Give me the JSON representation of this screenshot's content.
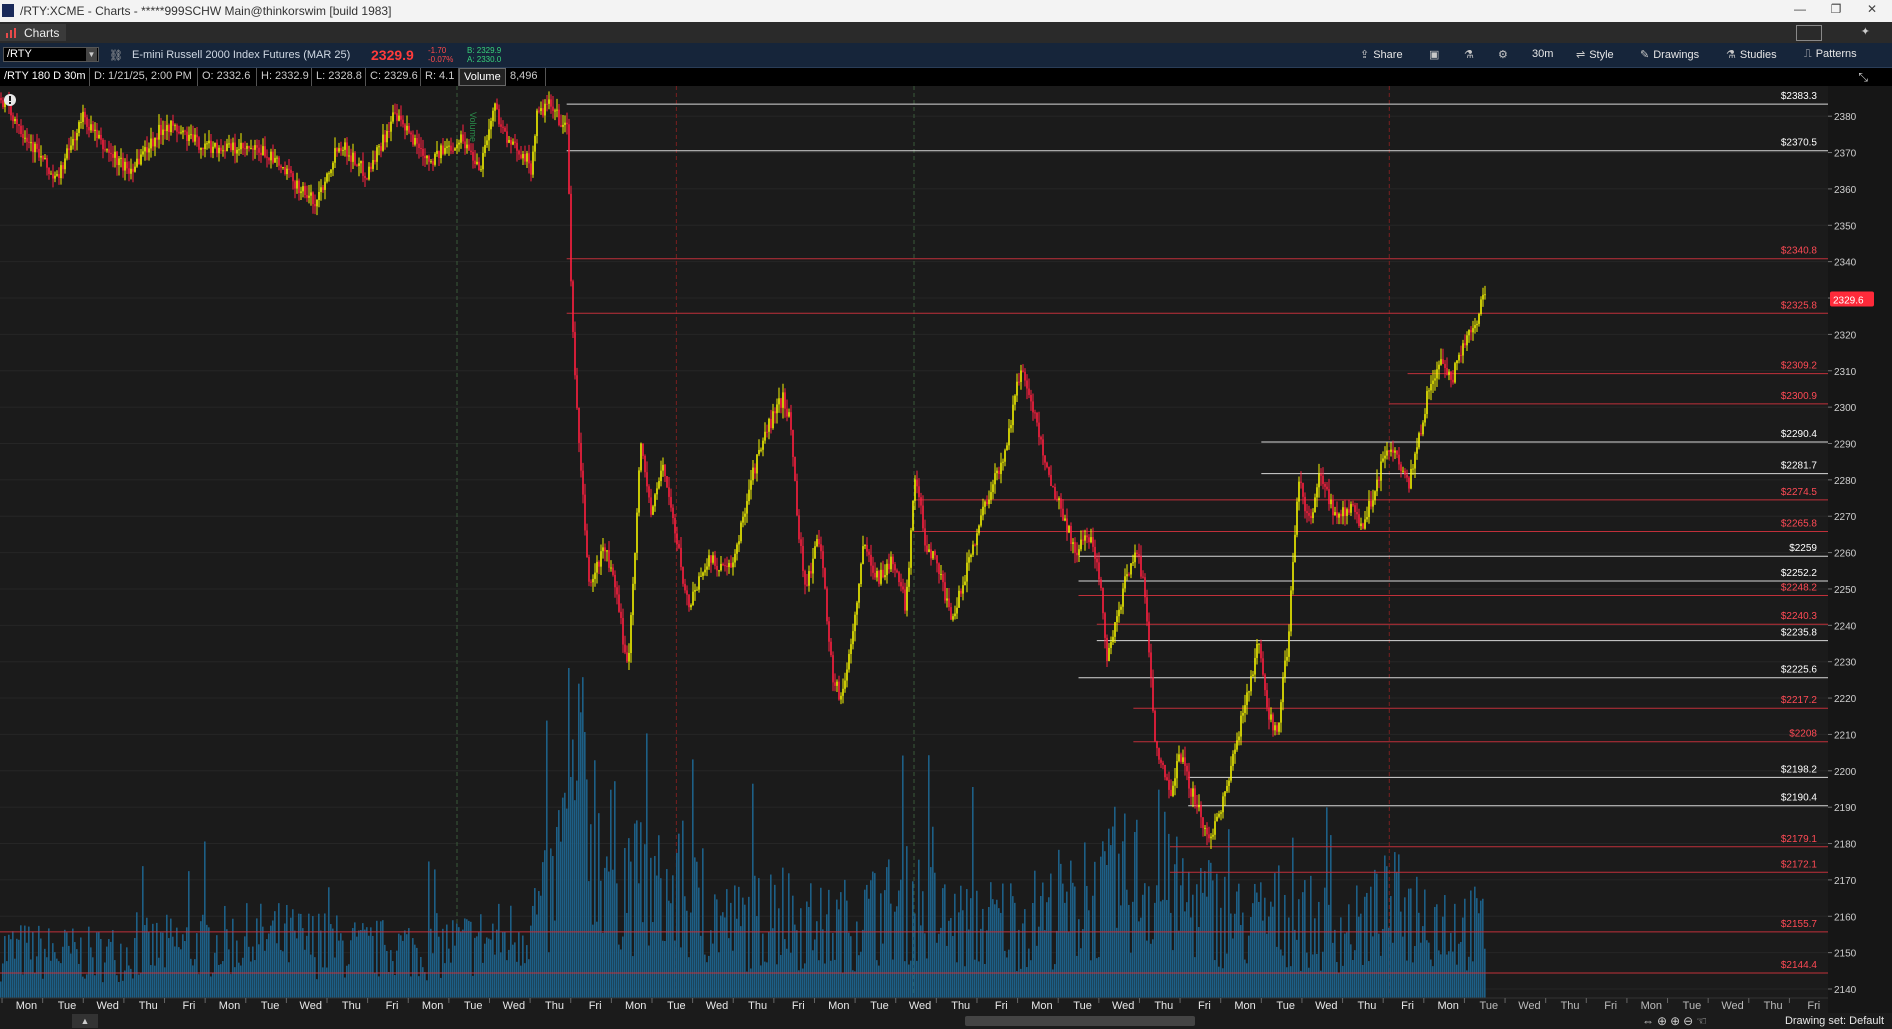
{
  "window": {
    "title": "/RTY:XCME - Charts - *****999SCHW Main@thinkorswim [build 1983]",
    "controls": [
      "—",
      "❐",
      "✕"
    ]
  },
  "tab": {
    "label": "Charts"
  },
  "toolbar": {
    "symbol": "/RTY",
    "description": "E-mini Russell 2000 Index Futures (MAR 25)",
    "last_price": "2329.9",
    "net_change": "-1.70",
    "pct_change": "-0.07%",
    "bid": "B: 2329.9",
    "ask": "A: 2330.0",
    "share_label": "Share",
    "interval_label": "30m",
    "style_label": "Style",
    "drawings_label": "Drawings",
    "studies_label": "Studies",
    "patterns_label": "Patterns"
  },
  "infobar": {
    "cells": [
      "/RTY 180 D 30m",
      "D: 1/21/25, 2:00 PM",
      "O: 2332.6",
      "H: 2332.9",
      "L: 2328.8",
      "C: 2329.6",
      "R: 4.1",
      "Volume",
      "8,496"
    ]
  },
  "chart_data": {
    "type": "candlestick",
    "instrument": "/RTY",
    "price_axis": {
      "min": 2140,
      "max": 2385,
      "step": 10,
      "ticks": [
        2140,
        2150,
        2160,
        2170,
        2180,
        2190,
        2200,
        2210,
        2220,
        2230,
        2240,
        2250,
        2260,
        2270,
        2280,
        2290,
        2300,
        2310,
        2320,
        2330,
        2340,
        2350,
        2360,
        2370,
        2380
      ]
    },
    "current_price": {
      "label": "2329.6",
      "value": 2329.6,
      "color": "#ff2a3a"
    },
    "price_levels": [
      {
        "label": "$2383.3",
        "value": 2383.3,
        "color": "white",
        "start": 0.31
      },
      {
        "label": "$2370.5",
        "value": 2370.5,
        "color": "white",
        "start": 0.31
      },
      {
        "label": "$2340.8",
        "value": 2340.8,
        "color": "red",
        "start": 0.31
      },
      {
        "label": "$2325.8",
        "value": 2325.8,
        "color": "red",
        "start": 0.31
      },
      {
        "label": "$2309.2",
        "value": 2309.2,
        "color": "red",
        "start": 0.77
      },
      {
        "label": "$2300.9",
        "value": 2300.9,
        "color": "red",
        "start": 0.76
      },
      {
        "label": "$2290.4",
        "value": 2290.4,
        "color": "white",
        "start": 0.69
      },
      {
        "label": "$2281.7",
        "value": 2281.7,
        "color": "white",
        "start": 0.69
      },
      {
        "label": "$2274.5",
        "value": 2274.5,
        "color": "red",
        "start": 0.5
      },
      {
        "label": "$2265.8",
        "value": 2265.8,
        "color": "red",
        "start": 0.5
      },
      {
        "label": "$2259",
        "value": 2259,
        "color": "white",
        "start": 0.59
      },
      {
        "label": "$2252.2",
        "value": 2252.2,
        "color": "white",
        "start": 0.59
      },
      {
        "label": "$2248.2",
        "value": 2248.2,
        "color": "red",
        "start": 0.59
      },
      {
        "label": "$2240.3",
        "value": 2240.3,
        "color": "red",
        "start": 0.6
      },
      {
        "label": "$2235.8",
        "value": 2235.8,
        "color": "white",
        "start": 0.6
      },
      {
        "label": "$2225.6",
        "value": 2225.6,
        "color": "white",
        "start": 0.59
      },
      {
        "label": "$2217.2",
        "value": 2217.2,
        "color": "red",
        "start": 0.62
      },
      {
        "label": "$2208",
        "value": 2208,
        "color": "red",
        "start": 0.62
      },
      {
        "label": "$2198.2",
        "value": 2198.2,
        "color": "white",
        "start": 0.65
      },
      {
        "label": "$2190.4",
        "value": 2190.4,
        "color": "white",
        "start": 0.65
      },
      {
        "label": "$2179.1",
        "value": 2179.1,
        "color": "red",
        "start": 0.64
      },
      {
        "label": "$2172.1",
        "value": 2172.1,
        "color": "red",
        "start": 0.64
      },
      {
        "label": "$2155.7",
        "value": 2155.7,
        "color": "red",
        "start": 0.0
      },
      {
        "label": "$2144.4",
        "value": 2144.4,
        "color": "red",
        "start": 0.0
      }
    ],
    "x_tick_labels": [
      "Mon",
      "Tue",
      "Wed",
      "Thu",
      "Fri",
      "Mon",
      "Tue",
      "Wed",
      "Thu",
      "Fri",
      "Mon",
      "Tue",
      "Wed",
      "Thu",
      "Fri",
      "Mon",
      "Tue",
      "Wed",
      "Thu",
      "Fri",
      "Mon",
      "Tue",
      "Wed",
      "Thu",
      "Fri",
      "Mon",
      "Tue",
      "Wed",
      "Thu",
      "Fri",
      "Mon",
      "Tue",
      "Wed",
      "Thu",
      "Fri",
      "Mon",
      "Tue",
      "Wed",
      "Thu",
      "Fri",
      "Mon",
      "Tue",
      "Wed",
      "Thu",
      "Fri"
    ],
    "last_data_label_index": 35,
    "day_separators_red": [
      0.37,
      0.76
    ],
    "day_separators_dashed": [
      0.25,
      0.5
    ],
    "series_label": "Volume",
    "anchors": [
      [
        0.0,
        2385
      ],
      [
        0.02,
        2370
      ],
      [
        0.03,
        2362
      ],
      [
        0.045,
        2380
      ],
      [
        0.055,
        2372
      ],
      [
        0.07,
        2365
      ],
      [
        0.09,
        2378
      ],
      [
        0.11,
        2372
      ],
      [
        0.145,
        2370
      ],
      [
        0.172,
        2356
      ],
      [
        0.185,
        2373
      ],
      [
        0.2,
        2364
      ],
      [
        0.215,
        2380
      ],
      [
        0.235,
        2368
      ],
      [
        0.252,
        2374
      ],
      [
        0.262,
        2366
      ],
      [
        0.27,
        2383
      ],
      [
        0.278,
        2372
      ],
      [
        0.286,
        2370
      ],
      [
        0.29,
        2365
      ],
      [
        0.293,
        2380
      ],
      [
        0.3,
        2383
      ],
      [
        0.31,
        2376
      ],
      [
        0.312,
        2330
      ],
      [
        0.316,
        2290
      ],
      [
        0.322,
        2250
      ],
      [
        0.33,
        2262
      ],
      [
        0.336,
        2250
      ],
      [
        0.343,
        2228
      ],
      [
        0.35,
        2290
      ],
      [
        0.356,
        2270
      ],
      [
        0.362,
        2285
      ],
      [
        0.37,
        2262
      ],
      [
        0.376,
        2245
      ],
      [
        0.386,
        2258
      ],
      [
        0.4,
        2255
      ],
      [
        0.41,
        2280
      ],
      [
        0.42,
        2295
      ],
      [
        0.428,
        2303
      ],
      [
        0.432,
        2295
      ],
      [
        0.436,
        2268
      ],
      [
        0.44,
        2250
      ],
      [
        0.448,
        2265
      ],
      [
        0.455,
        2225
      ],
      [
        0.46,
        2220
      ],
      [
        0.466,
        2238
      ],
      [
        0.472,
        2262
      ],
      [
        0.48,
        2253
      ],
      [
        0.488,
        2258
      ],
      [
        0.495,
        2245
      ],
      [
        0.5,
        2282
      ],
      [
        0.506,
        2262
      ],
      [
        0.512,
        2258
      ],
      [
        0.52,
        2240
      ],
      [
        0.528,
        2255
      ],
      [
        0.535,
        2268
      ],
      [
        0.54,
        2276
      ],
      [
        0.548,
        2285
      ],
      [
        0.553,
        2298
      ],
      [
        0.558,
        2311
      ],
      [
        0.562,
        2305
      ],
      [
        0.568,
        2292
      ],
      [
        0.575,
        2278
      ],
      [
        0.58,
        2272
      ],
      [
        0.588,
        2260
      ],
      [
        0.595,
        2265
      ],
      [
        0.6,
        2258
      ],
      [
        0.605,
        2232
      ],
      [
        0.61,
        2240
      ],
      [
        0.616,
        2255
      ],
      [
        0.622,
        2260
      ],
      [
        0.626,
        2248
      ],
      [
        0.632,
        2205
      ],
      [
        0.64,
        2195
      ],
      [
        0.645,
        2205
      ],
      [
        0.65,
        2196
      ],
      [
        0.655,
        2190
      ],
      [
        0.66,
        2180
      ],
      [
        0.666,
        2188
      ],
      [
        0.672,
        2198
      ],
      [
        0.68,
        2218
      ],
      [
        0.688,
        2235
      ],
      [
        0.692,
        2218
      ],
      [
        0.698,
        2210
      ],
      [
        0.704,
        2235
      ],
      [
        0.71,
        2280
      ],
      [
        0.716,
        2268
      ],
      [
        0.722,
        2282
      ],
      [
        0.73,
        2270
      ],
      [
        0.738,
        2272
      ],
      [
        0.745,
        2268
      ],
      [
        0.752,
        2278
      ],
      [
        0.758,
        2290
      ],
      [
        0.764,
        2285
      ],
      [
        0.77,
        2278
      ],
      [
        0.776,
        2292
      ],
      [
        0.781,
        2305
      ],
      [
        0.787,
        2312
      ],
      [
        0.794,
        2308
      ],
      [
        0.8,
        2318
      ],
      [
        0.806,
        2322
      ],
      [
        0.81,
        2330
      ],
      [
        0.813,
        2331
      ]
    ],
    "volume_axis": {
      "min": 0,
      "max": 100
    },
    "volume_anchors": [
      [
        0.0,
        20
      ],
      [
        0.05,
        18
      ],
      [
        0.1,
        22
      ],
      [
        0.15,
        25
      ],
      [
        0.2,
        20
      ],
      [
        0.25,
        22
      ],
      [
        0.28,
        26
      ],
      [
        0.3,
        40
      ],
      [
        0.31,
        70
      ],
      [
        0.32,
        85
      ],
      [
        0.33,
        60
      ],
      [
        0.35,
        45
      ],
      [
        0.37,
        42
      ],
      [
        0.38,
        38
      ],
      [
        0.4,
        30
      ],
      [
        0.43,
        35
      ],
      [
        0.45,
        28
      ],
      [
        0.5,
        40
      ],
      [
        0.52,
        30
      ],
      [
        0.55,
        32
      ],
      [
        0.58,
        35
      ],
      [
        0.6,
        40
      ],
      [
        0.62,
        50
      ],
      [
        0.64,
        42
      ],
      [
        0.66,
        38
      ],
      [
        0.68,
        30
      ],
      [
        0.7,
        35
      ],
      [
        0.72,
        30
      ],
      [
        0.74,
        28
      ],
      [
        0.76,
        38
      ],
      [
        0.78,
        35
      ],
      [
        0.8,
        30
      ],
      [
        0.813,
        28
      ]
    ]
  },
  "bottombar": {
    "drawing_set_label": "Drawing set: Default"
  }
}
